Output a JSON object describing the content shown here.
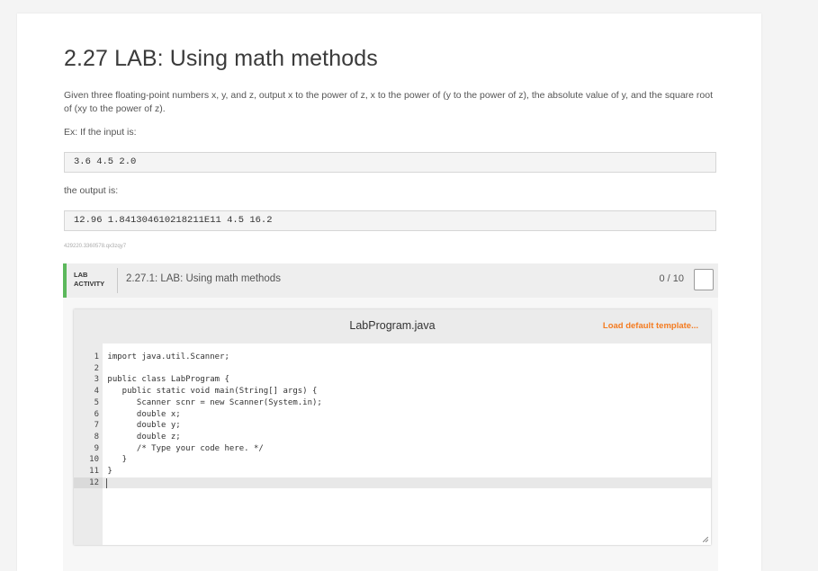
{
  "page": {
    "title": "2.27 LAB: Using math methods",
    "description": "Given three floating-point numbers x, y, and z, output x to the power of z, x to the power of (y to the power of z), the absolute value of y, and the square root of (xy to the power of z).",
    "example_intro": "Ex: If the input is:",
    "sample_input": "3.6 4.5 2.0",
    "output_intro": "the output is:",
    "sample_output": "12.96 1.841304610218211E11 4.5 16.2",
    "tracking_id": "429220.3360578.qx3zqy7"
  },
  "lab": {
    "tag_line1": "LAB",
    "tag_line2": "ACTIVITY",
    "name": "2.27.1: LAB: Using math methods",
    "score": "0 / 10",
    "accent_color": "#5cb85c"
  },
  "editor": {
    "filename": "LabProgram.java",
    "load_template_label": "Load default template...",
    "load_color": "#f47b20",
    "line_numbers": [
      "1",
      "2",
      "3",
      "4",
      "5",
      "6",
      "7",
      "8",
      "9",
      "10",
      "11",
      "12"
    ],
    "lines": [
      "import java.util.Scanner;",
      "",
      "public class LabProgram {",
      "   public static void main(String[] args) {",
      "      Scanner scnr = new Scanner(System.in);",
      "      double x;",
      "      double y;",
      "      double z;",
      "      /* Type your code here. */",
      "   }",
      "}",
      ""
    ],
    "active_line": 12
  }
}
